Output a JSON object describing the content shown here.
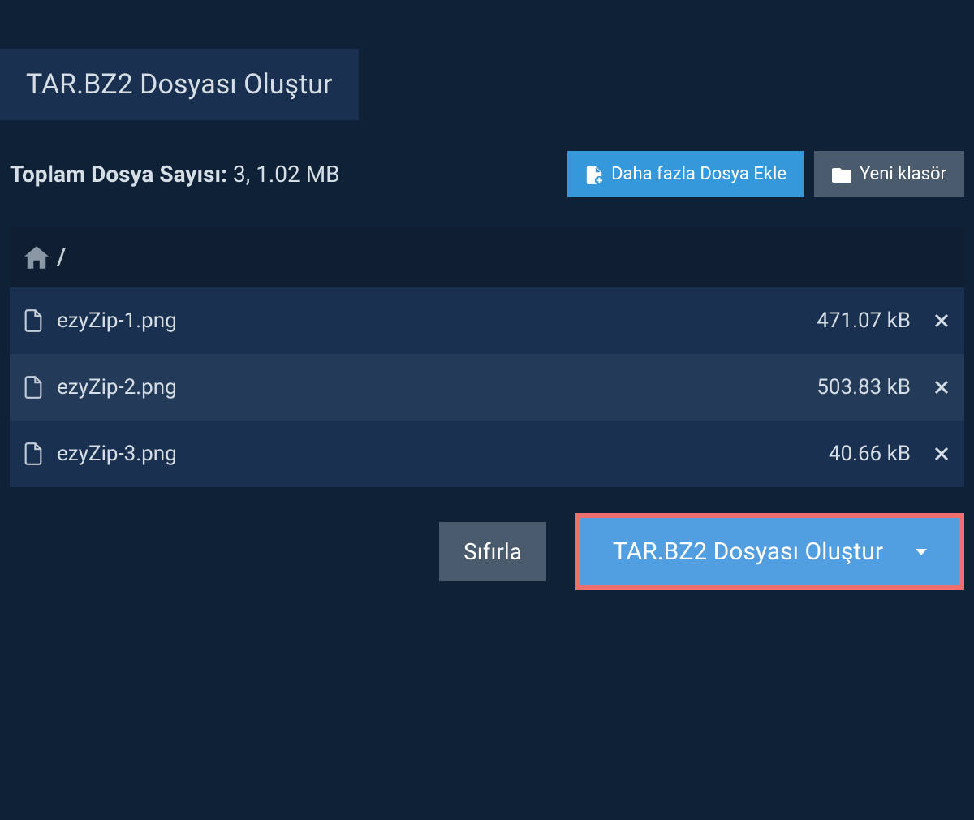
{
  "tab": {
    "title": "TAR.BZ2 Dosyası Oluştur"
  },
  "summary": {
    "label": "Toplam Dosya Sayısı:",
    "value": "3, 1.02 MB"
  },
  "buttons": {
    "add_files": "Daha fazla Dosya Ekle",
    "new_folder": "Yeni klasör",
    "reset": "Sıfırla",
    "create": "TAR.BZ2 Dosyası Oluştur"
  },
  "breadcrumb": {
    "path": "/"
  },
  "files": [
    {
      "name": "ezyZip-1.png",
      "size": "471.07 kB"
    },
    {
      "name": "ezyZip-2.png",
      "size": "503.83 kB"
    },
    {
      "name": "ezyZip-3.png",
      "size": "40.66 kB"
    }
  ]
}
